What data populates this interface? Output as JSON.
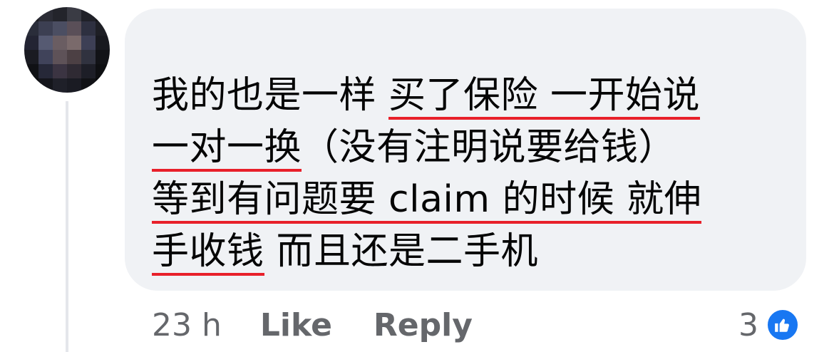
{
  "comment": {
    "author_name": "",
    "text_lines": [
      [
        {
          "t": "我的也是一样 ",
          "u": false
        },
        {
          "t": "买了保险 一开始说",
          "u": true
        }
      ],
      [
        {
          "t": "一对一换",
          "u": true
        },
        {
          "t": "（没有注明说要给钱）",
          "u": false
        }
      ],
      [
        {
          "t": "等到有问题要 claim 的时候 就伸",
          "u": true
        }
      ],
      [
        {
          "t": "手收钱",
          "u": true
        },
        {
          "t": " 而且还是二手机",
          "u": false
        }
      ]
    ],
    "timestamp": "23 h",
    "like_label": "Like",
    "reply_label": "Reply",
    "reaction_count": "3",
    "reaction_icon": "thumbs-up-icon"
  },
  "colors": {
    "bubble": "#f0f2f5",
    "text": "#050505",
    "meta_text": "#65676b",
    "underline": "#e8202a",
    "reaction_blue": "#1877f2"
  }
}
